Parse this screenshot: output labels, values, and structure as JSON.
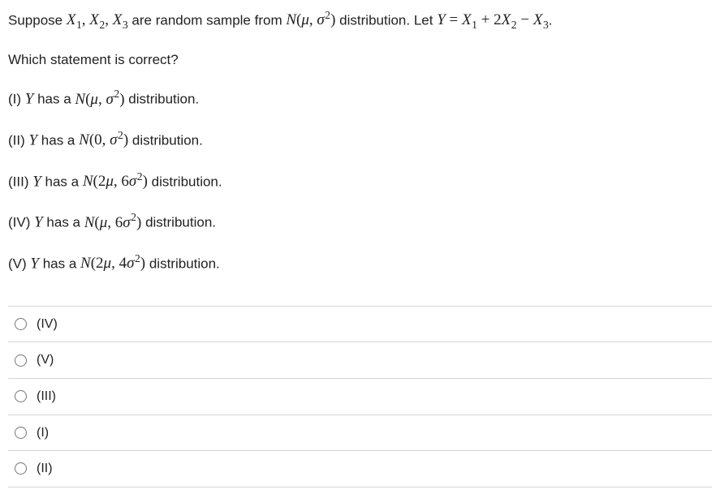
{
  "question": {
    "line1_a": "Suppose ",
    "line1_vars": "X",
    "line1_b": " are random sample from ",
    "line1_dist": "N(μ, σ²)",
    "line1_c": " distribution. Let ",
    "line1_eq_lhs": "Y",
    "line1_eq_eq": " = ",
    "line1_eq_rhs_a": "X",
    "line1_eq_rhs_plus": " + 2",
    "line1_eq_rhs_minus": " − ",
    "line1_d": ".",
    "line2": "Which statement is correct?",
    "s1_label": "(I) ",
    "s1_a": "Y",
    "s1_b": " has a ",
    "s1_dist_open": "N(μ, σ",
    "s1_dist_close": ")",
    "s1_c": " distribution.",
    "s2_label": "(II) ",
    "s2_a": "Y",
    "s2_b": " has a ",
    "s2_dist_open": "N(0, σ",
    "s2_dist_close": ")",
    "s2_c": " distribution.",
    "s3_label": "(III) ",
    "s3_a": "Y",
    "s3_b": " has a ",
    "s3_dist_open": "N(2μ, 6σ",
    "s3_dist_close": ")",
    "s3_c": " distribution.",
    "s4_label": "(IV) ",
    "s4_a": "Y",
    "s4_b": " has a ",
    "s4_dist_open": "N(μ, 6σ",
    "s4_dist_close": ")",
    "s4_c": " distribution.",
    "s5_label": "(V) ",
    "s5_a": "Y",
    "s5_b": " has a ",
    "s5_dist_open": "N(2μ, 4σ",
    "s5_dist_close": ")",
    "s5_c": " distribution."
  },
  "subs": {
    "one": "1",
    "two": "2",
    "three": "3",
    "sq": "2"
  },
  "options": {
    "a": "(IV)",
    "b": "(V)",
    "c": "(III)",
    "d": "(I)",
    "e": "(II)"
  }
}
